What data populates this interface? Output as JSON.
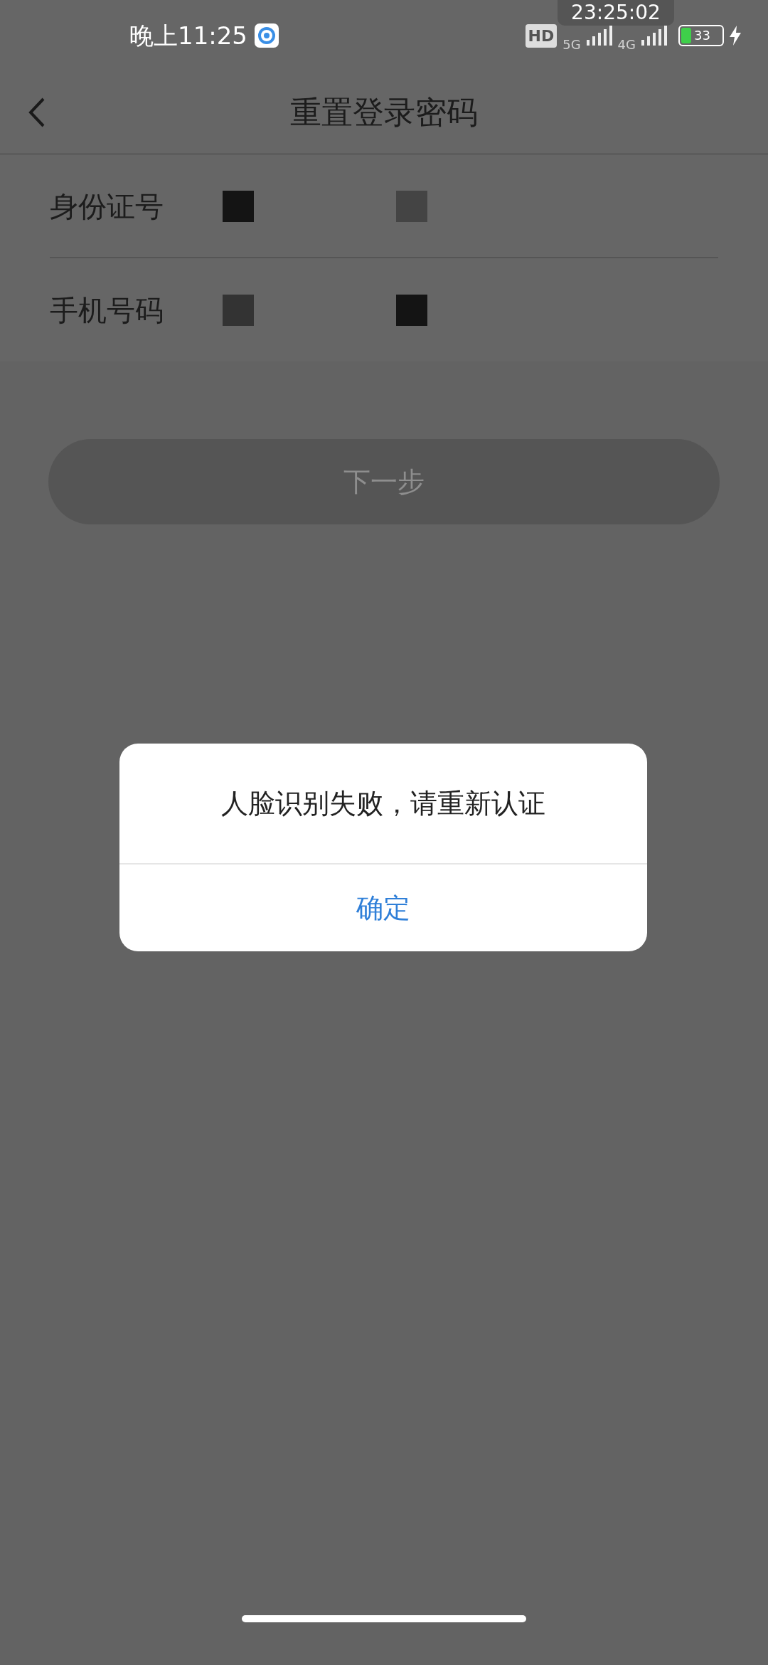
{
  "status_bar": {
    "time": "晚上11:25",
    "network_1": "5G",
    "network_2": "4G",
    "hd": "HD",
    "battery": "33",
    "clock_overlay": "23:25:02"
  },
  "header": {
    "title": "重置登录密码"
  },
  "form": {
    "fields": [
      {
        "label": "身份证号"
      },
      {
        "label": "手机号码"
      }
    ]
  },
  "next_button": {
    "label": "下一步",
    "disabled": true
  },
  "dialog": {
    "message": "人脸识别失败，请重新认证",
    "confirm": "确定"
  }
}
